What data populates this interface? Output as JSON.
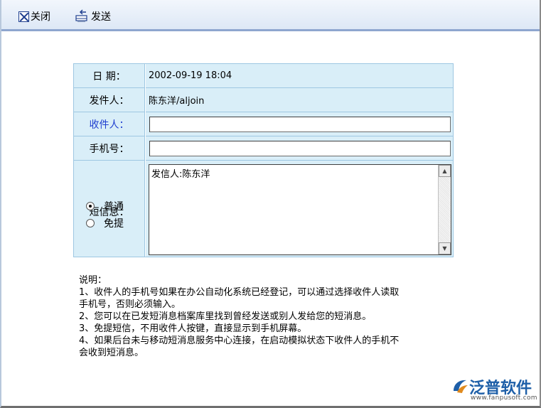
{
  "toolbar": {
    "close_label": "关闭",
    "send_label": "发送"
  },
  "form": {
    "date_label": "日 期：",
    "date_value": "2002-09-19 18:04",
    "sender_label": "发件人：",
    "sender_value": "陈东洋/aljoin",
    "recipient_label": "收件人：",
    "recipient_value": "",
    "mobile_label": "手机号：",
    "mobile_value": "",
    "message_label": "短信息：",
    "message_value": "发信人:陈东洋",
    "options": [
      {
        "label": "普通",
        "checked": true
      },
      {
        "label": "免提",
        "checked": false
      }
    ]
  },
  "notes": {
    "title": "说明：",
    "lines": [
      "1、收件人的手机号如果在办公自动化系统已经登记，可以通过选择收件人读取",
      "手机号，否则必须输入。",
      "2、您可以在已发短消息档案库里找到曾经发送或别人发给您的短消息。",
      "3、免提短信，不用收件人按键，直接显示到手机屏幕。",
      "4、如果后台未与移动短消息服务中心连接，在启动模拟状态下收件人的手机不",
      "会收到短消息。"
    ]
  },
  "logo": {
    "name": "泛普软件",
    "url": "www.fanpusoft.com"
  },
  "colors": {
    "label_bg": "#d9eef8",
    "border": "#9ec7e2",
    "highlight_label": "#1f3fd0",
    "brand": "#1e5fa8"
  }
}
